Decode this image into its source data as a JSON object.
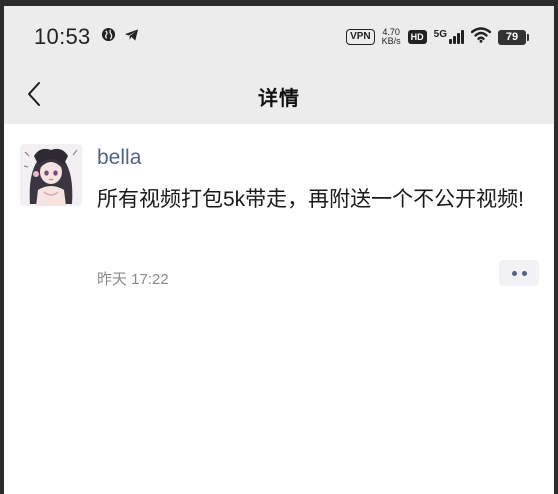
{
  "status_bar": {
    "time": "10:53",
    "vpn": "VPN",
    "speed_value": "4.70",
    "speed_unit": "KB/s",
    "hd": "HD",
    "network": "5G",
    "battery": "79"
  },
  "nav": {
    "title": "详情"
  },
  "post": {
    "author": "bella",
    "text": "所有视频打包5k带走，再附送一个不公开视频!",
    "time": "昨天 17:22"
  }
}
